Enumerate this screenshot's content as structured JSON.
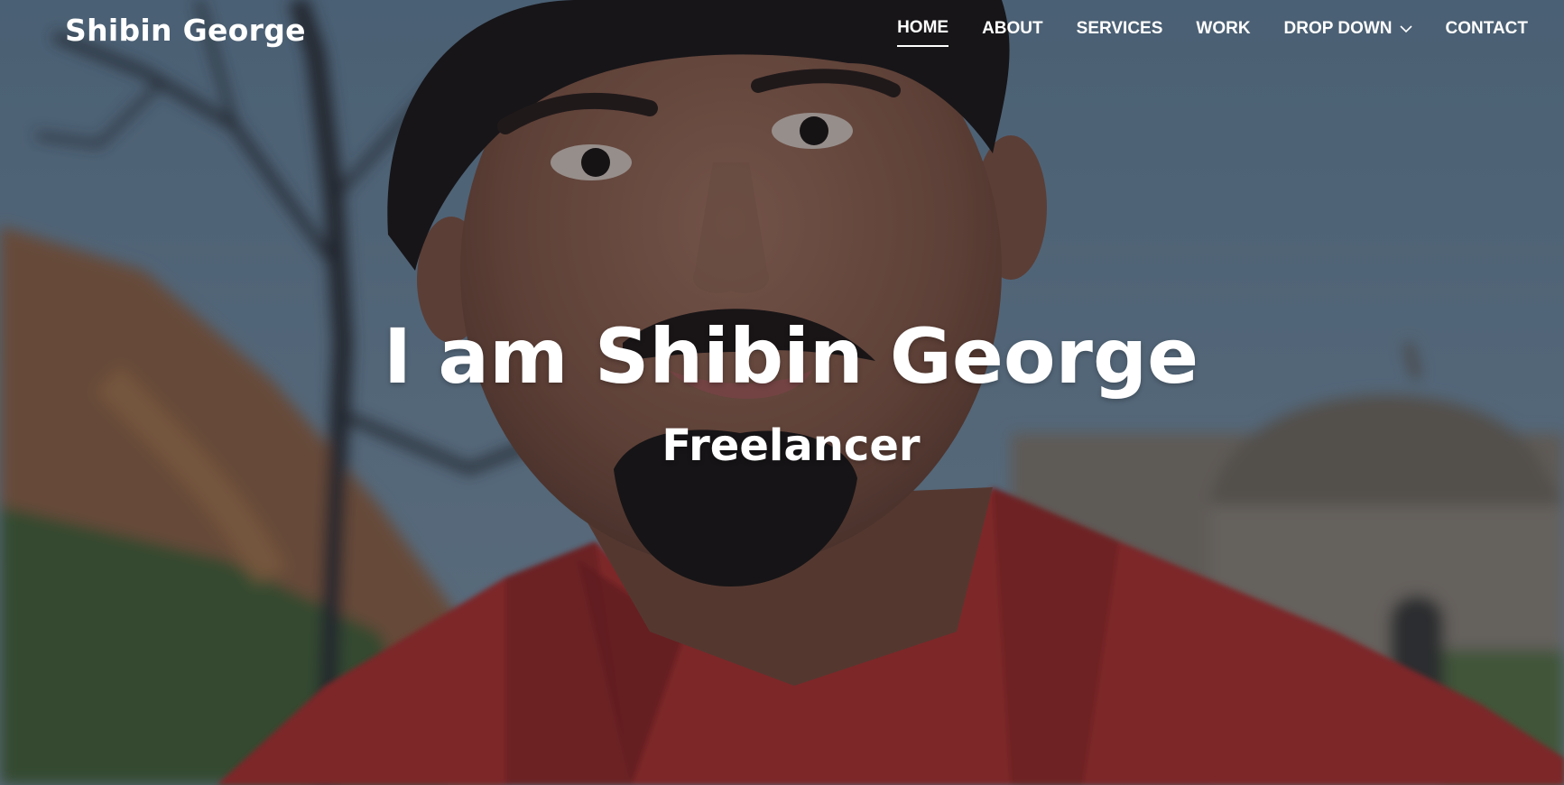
{
  "site": {
    "brand": "Shibin George"
  },
  "nav": {
    "items": [
      {
        "label": "HOME",
        "active": true
      },
      {
        "label": "ABOUT"
      },
      {
        "label": "SERVICES"
      },
      {
        "label": "WORK"
      },
      {
        "label": "DROP DOWN",
        "has_dropdown": true
      },
      {
        "label": "CONTACT"
      }
    ]
  },
  "hero": {
    "title": "I am Shibin George",
    "subtitle": "Freelancer"
  },
  "colors": {
    "text": "#ffffff",
    "overlay": "#0f1620",
    "shirt": "#c0332f"
  },
  "icons": {
    "dropdown": "chevron-down-icon"
  }
}
